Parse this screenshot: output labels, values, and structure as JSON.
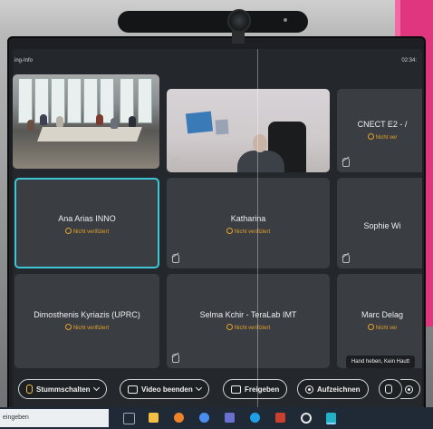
{
  "meeting": {
    "info_label": "ing-Info",
    "clock": "02:34:"
  },
  "participants": [
    {
      "name": "",
      "status": "",
      "kind": "room-video"
    },
    {
      "name": "",
      "status": "",
      "kind": "person-video"
    },
    {
      "name": "CNECT E2 - /",
      "status": "Nicht ver"
    },
    {
      "name": "Ana Arias INNO",
      "status": "Nicht verifiziert",
      "active": true
    },
    {
      "name": "Katharina",
      "status": "Nicht verifiziert"
    },
    {
      "name": "Sophie Wi",
      "status": ""
    },
    {
      "name": "Dimosthenis Kyriazis (UPRC)",
      "status": "Nicht verifiziert"
    },
    {
      "name": "Selma Kchir - TeraLab IMT",
      "status": "Nicht verifiziert"
    },
    {
      "name": "Marc Delag",
      "status": "Nicht ver"
    }
  ],
  "toolbar": {
    "mute_label": "Stummschalten",
    "video_label": "Video beenden",
    "share_label": "Freigeben",
    "record_label": "Aufzeichnen"
  },
  "hint": "Hand heben, Kein Hautt",
  "taskbar": {
    "search_placeholder": "eingeben",
    "icons": [
      "task-view-icon",
      "file-explorer-icon",
      "firefox-icon",
      "chrome-icon",
      "teams-icon",
      "edge-icon",
      "powerpoint-icon",
      "cortana-icon",
      "webex-icon"
    ]
  },
  "colors": {
    "accent_active": "#3fc6d6",
    "status_warning": "#e3a32c",
    "pink_wall": "#e0367f"
  }
}
